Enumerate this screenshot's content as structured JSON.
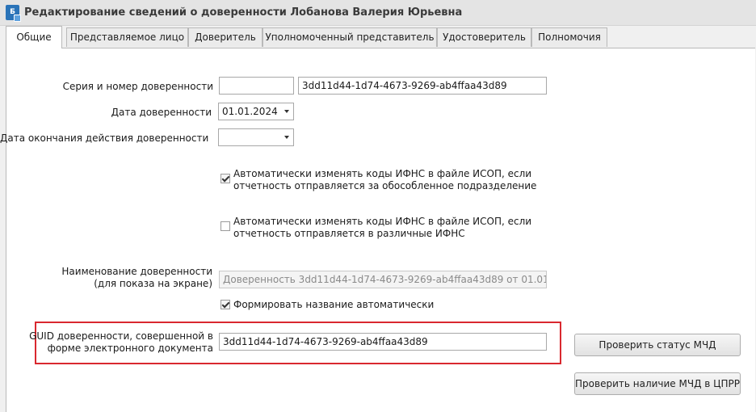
{
  "window": {
    "title": "Редактирование сведений о доверенности Лобанова Валерия Юрьевна",
    "icon": "document-app-icon",
    "icon_text": "Б"
  },
  "tabs": [
    {
      "label": "Общие",
      "active": true
    },
    {
      "label": "Представляемое лицо",
      "active": false
    },
    {
      "label": "Доверитель",
      "active": false
    },
    {
      "label": "Уполномоченный представитель",
      "active": false
    },
    {
      "label": "Удостоверитель",
      "active": false
    },
    {
      "label": "Полномочия",
      "active": false
    }
  ],
  "form": {
    "series_label": "Серия и номер доверенности",
    "series_value": "",
    "number_value": "3dd11d44-1d74-4673-9269-ab4ffaa43d89",
    "date_label": "Дата доверенности",
    "date_value": "01.01.2024",
    "end_date_label": "Дата окончания действия доверенности",
    "end_date_value": "",
    "auto_ifns_separate": {
      "checked": true,
      "line1": "Автоматически изменять коды ИФНС в файле ИСОП, если",
      "line2": "отчетность отправляется за обособленное подразделение"
    },
    "auto_ifns_various": {
      "checked": false,
      "line1": "Автоматически изменять коды ИФНС в файле ИСОП, если",
      "line2": "отчетность отправляется в различные ИФНС"
    },
    "name_label_line1": "Наименование доверенности",
    "name_label_line2": "(для показа на экране)",
    "name_value": "Доверенность  3dd11d44-1d74-4673-9269-ab4ffaa43d89 от 01.01...",
    "auto_name": {
      "checked": true,
      "label": "Формировать название автоматически"
    },
    "guid_label_line1": "GUID доверенности, совершенной в",
    "guid_label_line2": "форме электронного документа",
    "guid_value": "3dd11d44-1d74-4673-9269-ab4ffaa43d89"
  },
  "buttons": {
    "check_status": "Проверить статус МЧД",
    "check_presence": "Проверить наличие МЧД в ЦПРР"
  },
  "colors": {
    "highlight": "#d9282f",
    "panel": "#ffffff",
    "background": "#f0f0f0"
  }
}
